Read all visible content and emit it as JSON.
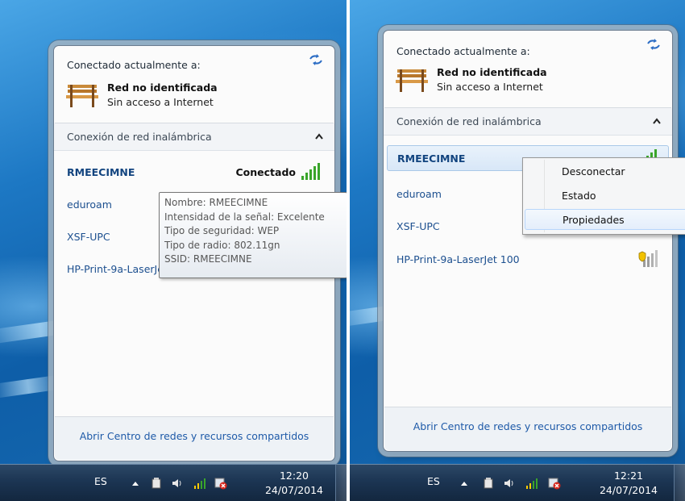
{
  "left": {
    "current_title": "Conectado actualmente a:",
    "network_name": "Red no identificada",
    "network_status": "Sin acceso a Internet",
    "section_label": "Conexión de red inalámbrica",
    "networks": [
      {
        "ssid": "RMEECIMNE",
        "state": "Conectado"
      },
      {
        "ssid": "eduroam"
      },
      {
        "ssid": "XSF-UPC"
      },
      {
        "ssid": "HP-Print-9a-LaserJet 100"
      }
    ],
    "tooltip": [
      "Nombre: RMEECIMNE",
      "Intensidad de la señal: Excelente",
      "Tipo de seguridad: WEP",
      "Tipo de radio: 802.11gn",
      "SSID: RMEECIMNE"
    ],
    "footer_link": "Abrir Centro de redes y recursos compartidos",
    "taskbar": {
      "lang": "ES",
      "time": "12:20",
      "date": "24/07/2014"
    }
  },
  "right": {
    "current_title": "Conectado actualmente a:",
    "network_name": "Red no identificada",
    "network_status": "Sin acceso a Internet",
    "section_label": "Conexión de red inalámbrica",
    "networks": [
      {
        "ssid": "RMEECIMNE"
      },
      {
        "ssid": "eduroam"
      },
      {
        "ssid": "XSF-UPC"
      },
      {
        "ssid": "HP-Print-9a-LaserJet 100"
      }
    ],
    "context_menu": [
      "Desconectar",
      "Estado",
      "Propiedades"
    ],
    "footer_link": "Abrir Centro de redes y recursos compartidos",
    "taskbar": {
      "lang": "ES",
      "time": "12:21",
      "date": "24/07/2014"
    }
  },
  "colors": {
    "link": "#1e5aa8",
    "signal": "#3aa52a",
    "taskbar": "#1c3553"
  }
}
